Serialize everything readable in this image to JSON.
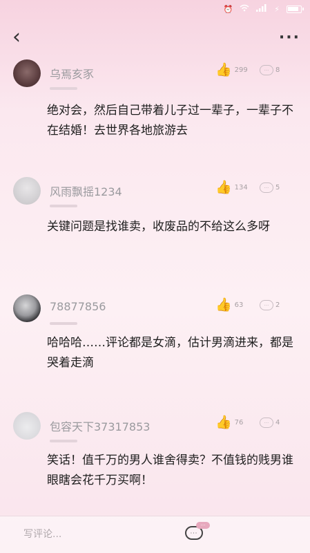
{
  "status_bar": {
    "icons": [
      "alarm-icon",
      "wifi-icon",
      "signal-icon",
      "charging-icon",
      "battery-icon"
    ]
  },
  "nav": {
    "back_label": "‹",
    "more_label": "···"
  },
  "comments": [
    {
      "username": "乌焉亥豕",
      "likes": "299",
      "replies": "8",
      "text": "绝对会，然后自己带着儿子过一辈子，一辈子不在结婚！去世界各地旅游去"
    },
    {
      "username": "风雨飘摇1234",
      "likes": "134",
      "replies": "5",
      "text": "关键问题是找谁卖，收废品的不给这么多呀"
    },
    {
      "username": "78877856",
      "likes": "63",
      "replies": "2",
      "text": "哈哈哈……评论都是女滴，估计男滴进来，都是哭着走滴"
    },
    {
      "username": "包容天下37317853",
      "likes": "76",
      "replies": "4",
      "text": "笑话！值千万的男人谁舍得卖？不值钱的贱男谁眼瞎会花千万买啊！"
    }
  ],
  "bottom_bar": {
    "input_placeholder": "写评论...",
    "chat_icon_label": "···",
    "chat_badge": "···"
  },
  "colors": {
    "like_accent": "#d9577a",
    "background": "#fbe6ef"
  }
}
